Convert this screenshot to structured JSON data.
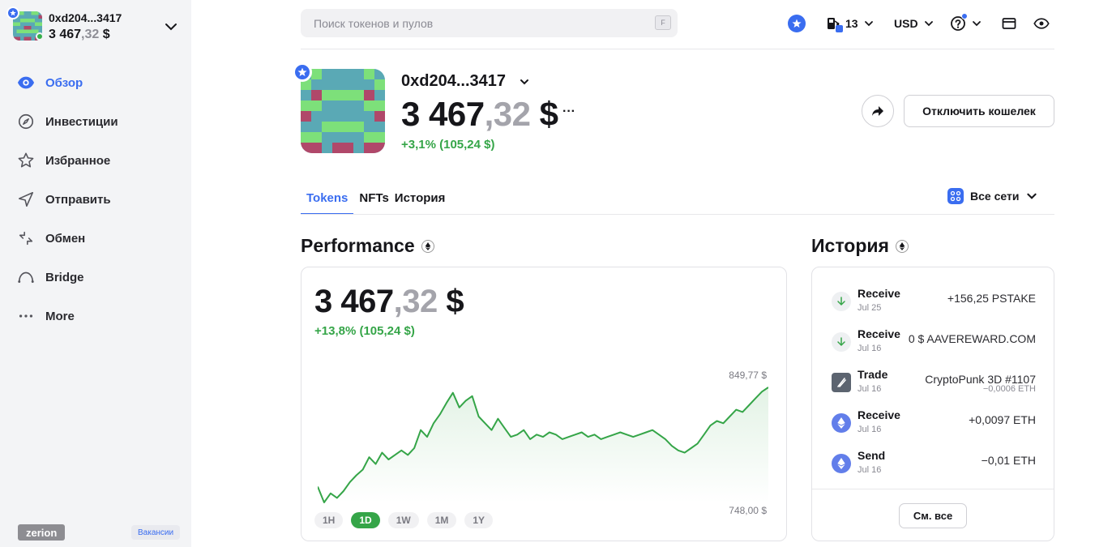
{
  "wallet": {
    "address_short": "0xd204...3417",
    "balance_int": "3 467",
    "balance_dec": ",32",
    "balance_cur": " $"
  },
  "sidebar": {
    "items": [
      {
        "label": "Обзор",
        "icon": "eye-icon",
        "active": true
      },
      {
        "label": "Инвестиции",
        "icon": "compass-icon"
      },
      {
        "label": "Избранное",
        "icon": "star-icon"
      },
      {
        "label": "Отправить",
        "icon": "send-icon"
      },
      {
        "label": "Обмен",
        "icon": "swap-icon"
      },
      {
        "label": "Bridge",
        "icon": "bridge-icon"
      },
      {
        "label": "More",
        "icon": "more-icon"
      }
    ],
    "logo": "zerion",
    "jobs": "Вакансии"
  },
  "topbar": {
    "search_placeholder": "Поиск токенов и пулов",
    "search_key": "F",
    "gas": "13",
    "currency": "USD"
  },
  "profile": {
    "address": "0xd204...3417",
    "balance_int": "3 467",
    "balance_dec": ",32",
    "balance_cur": " $",
    "more": "···",
    "change": "+3,1% (105,24 $)",
    "disconnect": "Отключить кошелек"
  },
  "tabs": [
    "Tokens",
    "NFTs",
    "История"
  ],
  "networks_label": "Все сети",
  "performance": {
    "title": "Performance",
    "balance_int": "3 467",
    "balance_dec": ",32",
    "balance_cur": " $",
    "change": "+13,8% (105,24 $)",
    "max_label": "849,77 $",
    "min_label": "748,00 $",
    "ranges": [
      "1H",
      "1D",
      "1W",
      "1M",
      "1Y"
    ],
    "active_range": "1D"
  },
  "chart_data": {
    "type": "line",
    "ylim": [
      748.0,
      849.77
    ],
    "values": [
      762,
      748,
      756,
      752,
      758,
      766,
      772,
      777,
      788,
      782,
      792,
      786,
      790,
      794,
      790,
      796,
      812,
      806,
      818,
      826,
      836,
      845,
      832,
      838,
      842,
      824,
      818,
      812,
      822,
      814,
      806,
      808,
      812,
      804,
      808,
      806,
      810,
      808,
      804,
      806,
      808,
      810,
      806,
      808,
      804,
      806,
      808,
      810,
      808,
      806,
      808,
      810,
      812,
      808,
      804,
      798,
      794,
      792,
      796,
      800,
      808,
      816,
      820,
      818,
      824,
      830,
      828,
      834,
      840,
      846,
      849.77
    ],
    "color": "#35a548"
  },
  "history": {
    "title": "История",
    "items": [
      {
        "type": "Receive",
        "date": "Jul 25",
        "amount": "+156,25 PSTAKE",
        "sub": "",
        "icon": "arrow-down-icon"
      },
      {
        "type": "Receive",
        "date": "Jul 16",
        "amount": "0 $ AAVEREWARD.COM",
        "sub": "",
        "icon": "arrow-down-icon"
      },
      {
        "type": "Trade",
        "date": "Jul 16",
        "amount": "CryptoPunk 3D #1107",
        "sub": "−0,0006 ETH",
        "icon": "nft-icon"
      },
      {
        "type": "Receive",
        "date": "Jul 16",
        "amount": "+0,0097 ETH",
        "sub": "",
        "icon": "eth-icon"
      },
      {
        "type": "Send",
        "date": "Jul 16",
        "amount": "−0,01 ETH",
        "sub": "",
        "icon": "eth-icon"
      }
    ],
    "see_all": "См. все"
  },
  "colors": {
    "accent": "#3a6df0",
    "positive": "#35a548",
    "avatar_teal": "#5aa9b5",
    "avatar_green": "#7de07a",
    "avatar_red": "#b0486a"
  }
}
